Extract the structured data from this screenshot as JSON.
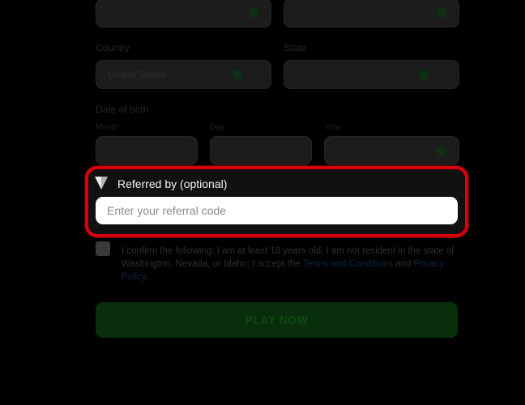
{
  "form": {
    "row1": {
      "left_value": "",
      "right_value": ""
    },
    "country": {
      "label": "Country",
      "value": "United States"
    },
    "state": {
      "label": "State",
      "placeholder": ""
    },
    "dob": {
      "label": "Date of birth",
      "month_label": "Month",
      "day_label": "Day",
      "year_label": "Year"
    },
    "referral": {
      "label": "Referred by (optional)",
      "placeholder": "Enter your referral code"
    },
    "confirm": {
      "text_before": "I confirm the following: I am at least 18 years old; I am not resident in the state of Washington, Nevada, or Idaho; I accept the ",
      "terms_link": "Terms and Conditions",
      "text_and": " and ",
      "privacy_link": "Privacy Policy",
      "text_end": "."
    },
    "play_button": "PLAY NOW"
  },
  "colors": {
    "highlight": "#d8000c",
    "accent_green": "#14a42a"
  },
  "icons": {
    "valid": "check-circle-icon",
    "dropdown": "chevron-down-icon",
    "referral": "shield-icon"
  }
}
